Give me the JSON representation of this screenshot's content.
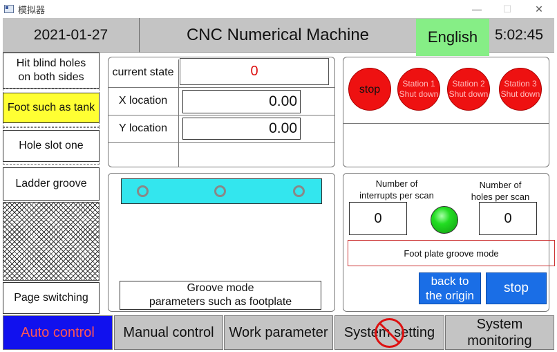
{
  "window": {
    "title": "模拟器",
    "minimize": "—",
    "maximize": "☐",
    "close": "✕"
  },
  "header": {
    "date": "2021-01-27",
    "title": "CNC Numerical Machine",
    "language_button": "English",
    "time": "5:02:45"
  },
  "sidebar": {
    "items": [
      {
        "line1": "Hit blind holes",
        "line2": "on both sides"
      },
      {
        "label": "Foot such as tank"
      },
      {
        "label": "Hole slot one"
      },
      {
        "label": "Ladder groove"
      }
    ],
    "page_switching": "Page switching"
  },
  "state_panel": {
    "current_state_label": "current state",
    "current_state_value": "0",
    "x_label": "X location",
    "x_value": "0.00",
    "y_label": "Y location",
    "y_value": "0.00"
  },
  "station_panel": {
    "stop": "stop",
    "stations": [
      {
        "line1": "Station 1",
        "line2": "Shut down"
      },
      {
        "line1": "Station 2",
        "line2": "Shut down"
      },
      {
        "line1": "Station 3",
        "line2": "Shut down"
      }
    ]
  },
  "groove_panel": {
    "mode_line1": "Groove mode",
    "mode_line2": "parameters such as footplate"
  },
  "scan_panel": {
    "interrupts_line1": "Number of",
    "interrupts_line2": "interrupts per scan",
    "interrupts_value": "0",
    "holes_line1": "Number of",
    "holes_line2": "holes per scan",
    "holes_value": "0",
    "mode_text": "Foot plate groove mode",
    "back_line1": "back to",
    "back_line2": "the origin",
    "stop": "stop"
  },
  "bottom_nav": {
    "auto": "Auto control",
    "manual": "Manual control",
    "work": "Work parameter",
    "system_setting": "System setting",
    "monitor_line1": "System",
    "monitor_line2": "monitoring"
  },
  "colors": {
    "accent_green": "#86ee86",
    "stop_red": "#ee1111",
    "button_blue": "#1a6ee6",
    "highlight_yellow": "#ffff33",
    "active_tab_blue": "#1111ee",
    "rail_cyan": "#33e6ee"
  }
}
